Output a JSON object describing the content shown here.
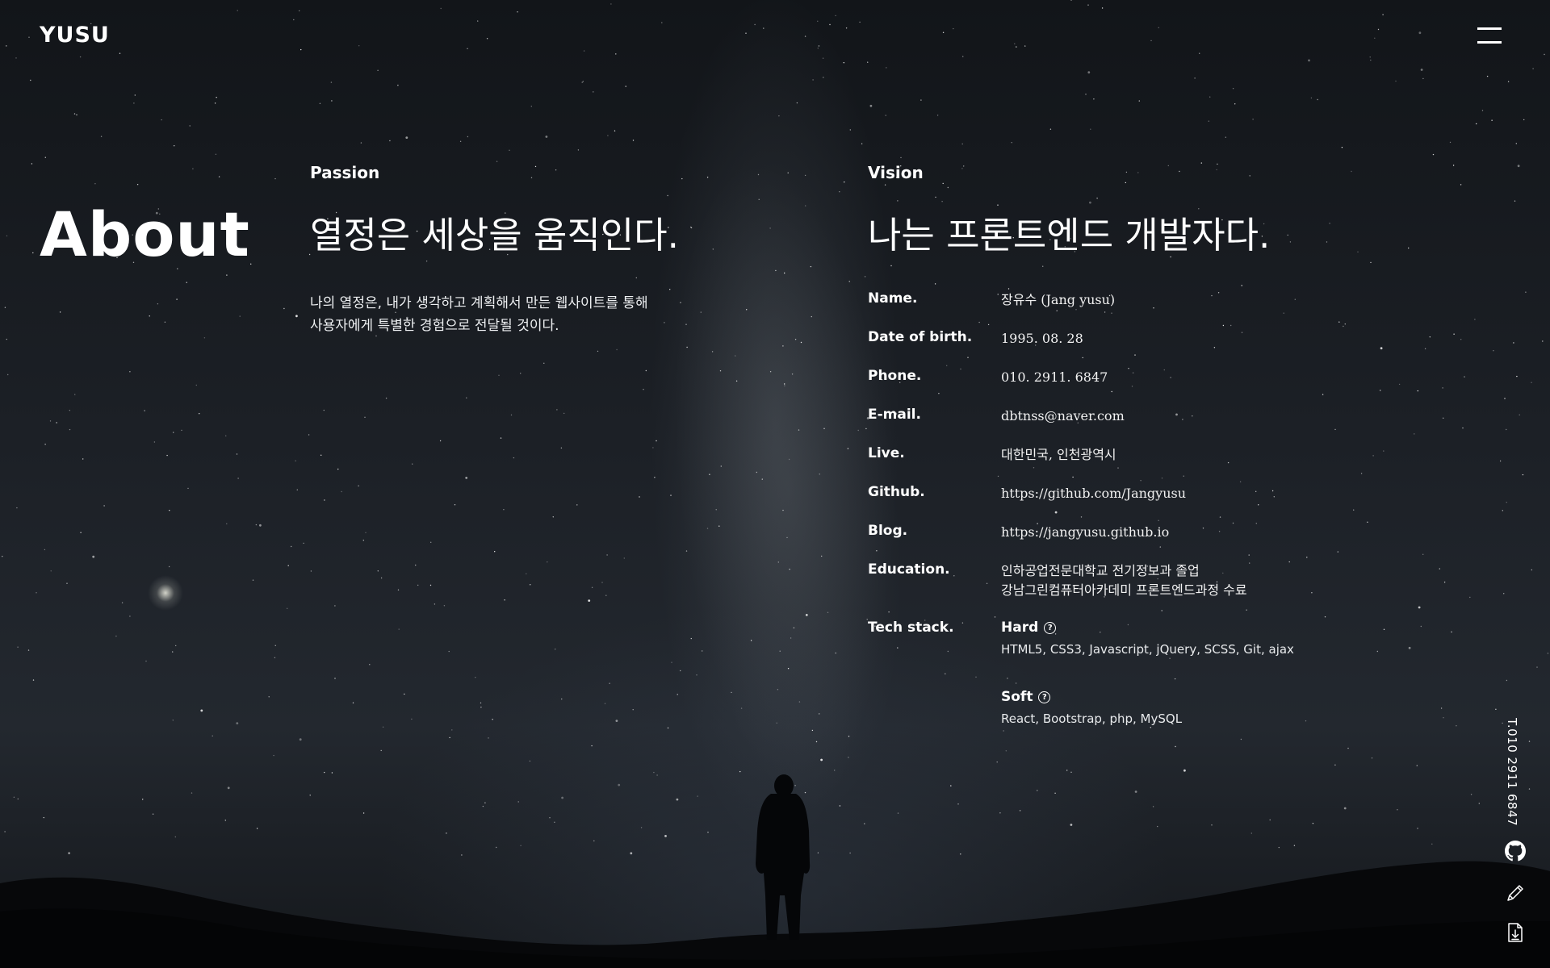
{
  "header": {
    "logo": "YUSU",
    "menu_icon": "hamburger-menu-icon"
  },
  "about": {
    "title": "About"
  },
  "passion": {
    "label": "Passion",
    "headline": "열정은 세상을 움직인다.",
    "text_lines": [
      "나의 열정은, 내가 생각하고 계획해서 만든 웹사이트를 통해",
      "사용자에게 특별한 경험으로 전달될 것이다."
    ]
  },
  "vision": {
    "label": "Vision",
    "headline": "나는 프론트엔드 개발자다."
  },
  "profile": {
    "name": {
      "label": "Name.",
      "value": "장유수 (Jang yusu)"
    },
    "birth": {
      "label": "Date of birth.",
      "value": "1995. 08. 28"
    },
    "phone": {
      "label": "Phone.",
      "value": "010. 2911. 6847"
    },
    "email": {
      "label": "E-mail.",
      "value": "dbtnss@naver.com"
    },
    "live": {
      "label": "Live.",
      "value": "대한민국, 인천광역시"
    },
    "github": {
      "label": "Github.",
      "value": "https://github.com/Jangyusu"
    },
    "blog": {
      "label": "Blog.",
      "value": "https://jangyusu.github.io"
    },
    "education": {
      "label": "Education.",
      "lines": [
        "인하공업전문대학교 전기정보과 졸업",
        "강남그린컴퓨터아카데미 프론트엔드과정 수료"
      ]
    },
    "tech": {
      "label": "Tech stack.",
      "hard_label": "Hard",
      "hard_items": "HTML5, CSS3, Javascript, jQuery, SCSS, Git, ajax",
      "soft_label": "Soft",
      "soft_items": "React, Bootstrap, php, MySQL",
      "help_glyph": "?"
    }
  },
  "sidebar": {
    "phone": "T.010 2911 6847",
    "icons": [
      "github-icon",
      "pencil-icon",
      "download-icon"
    ]
  }
}
